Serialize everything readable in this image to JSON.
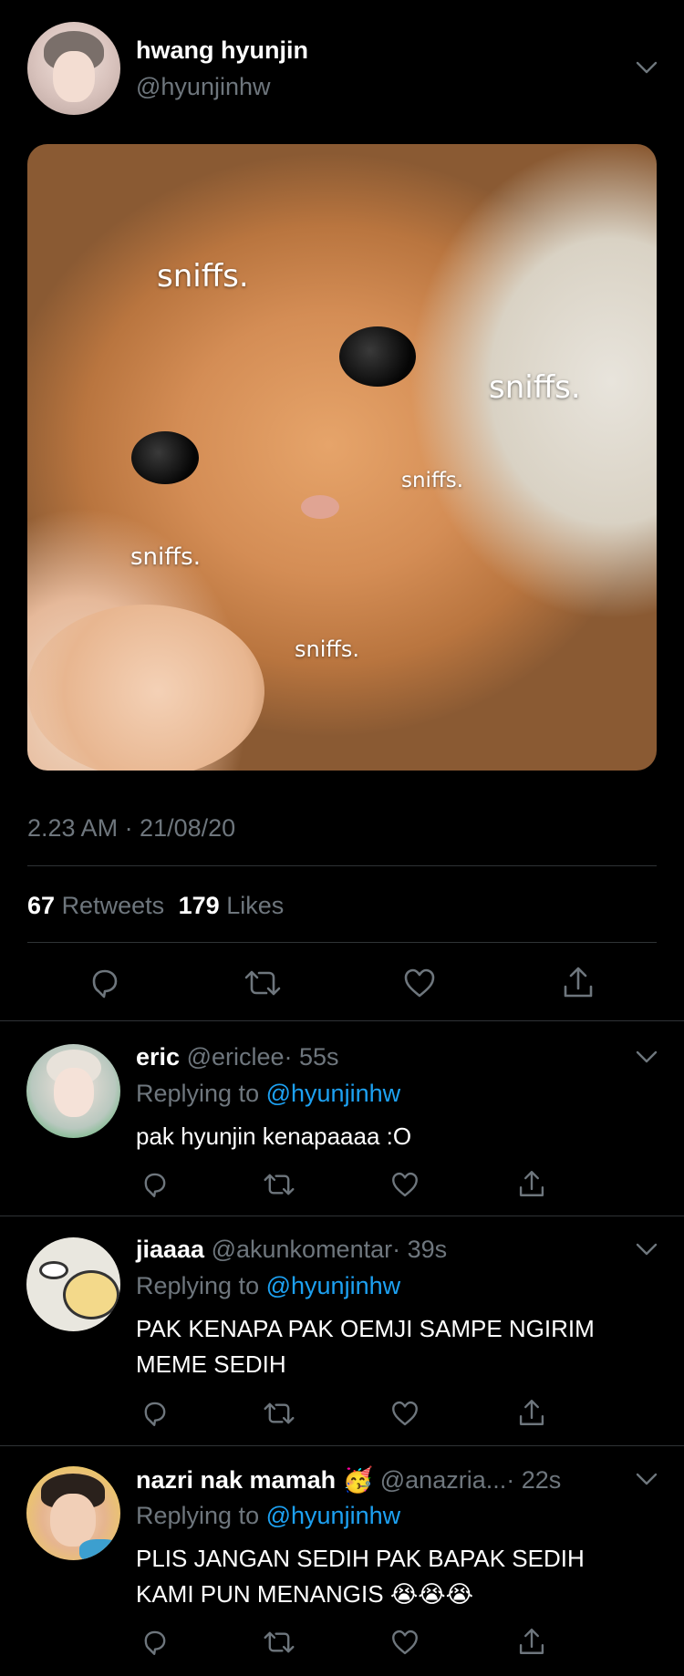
{
  "tweet": {
    "display_name": "hwang hyunjin",
    "handle": "@hyunjinhw",
    "image_captions": [
      "sniffs.",
      "sniffs.",
      "sniffs.",
      "sniffs.",
      "sniffs."
    ],
    "timestamp": "2.23 AM · 21/08/20",
    "retweets_count": "67",
    "retweets_label": "Retweets",
    "likes_count": "179",
    "likes_label": "Likes"
  },
  "replies": [
    {
      "display_name": "eric",
      "handle": "@ericlee",
      "time": "· 55s",
      "replying_prefix": "Replying to",
      "replying_handle": "@hyunjinhw",
      "text_lines": [
        "pak hyunjin kenapaaaa :O"
      ]
    },
    {
      "display_name": "jiaaaa",
      "handle": "@akunkomentar",
      "time": "· 39s",
      "replying_prefix": "Replying to",
      "replying_handle": "@hyunjinhw",
      "text_lines": [
        "PAK KENAPA PAK OEMJI SAMPE NGIRIM",
        "MEME SEDIH"
      ]
    },
    {
      "display_name": "nazri nak mamah",
      "name_emoji": "🥳",
      "handle": "@anazria...",
      "time": "· 22s",
      "replying_prefix": "Replying to",
      "replying_handle": "@hyunjinhw",
      "text_lines": [
        "PLIS JANGAN SEDIH PAK BAPAK SEDIH",
        "KAMI PUN MENANGIS 😭😭😭"
      ]
    }
  ],
  "icons": {
    "chevron": "chevron-down-icon",
    "reply": "reply-icon",
    "retweet": "retweet-icon",
    "like": "heart-icon",
    "share": "share-icon"
  },
  "colors": {
    "background": "#000000",
    "muted": "#6e767d",
    "link": "#1da1f2",
    "divider": "#2f3336"
  }
}
